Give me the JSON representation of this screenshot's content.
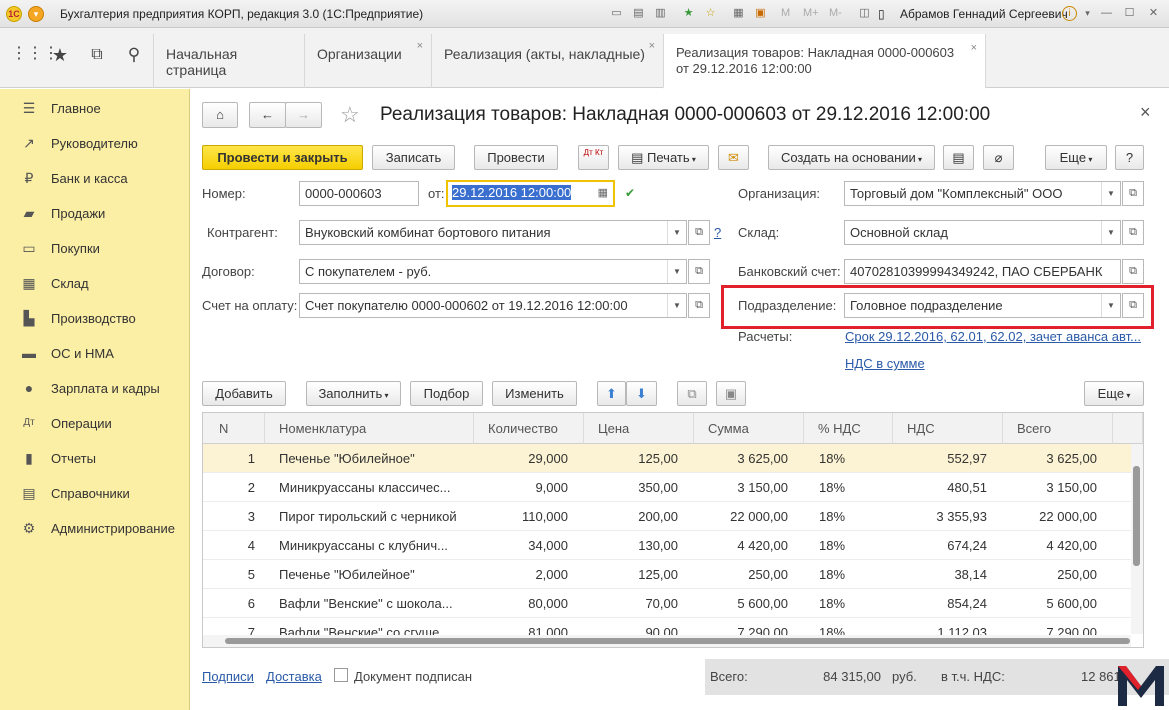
{
  "window": {
    "title": "Бухгалтерия предприятия КОРП, редакция 3.0  (1С:Предприятие)",
    "toolbar_icons": [
      "monitor-icon",
      "printer-icon",
      "printer-2-icon",
      "bookmark-icon",
      "star-icon",
      "calculator-icon",
      "calendar-icon",
      "copy-icon"
    ],
    "memory_labels": [
      "M",
      "M+",
      "M-"
    ],
    "user": "Абрамов Геннадий Сергеевич",
    "info_icon": "info-icon",
    "minimize": "—",
    "maximize": "☐",
    "close": "✕"
  },
  "topnav": {
    "icons": [
      "apps-grid-icon",
      "star-icon",
      "history-icon",
      "search-icon"
    ],
    "tabs": [
      {
        "label": "Начальная страница",
        "closable": false
      },
      {
        "label": "Организации",
        "closable": true
      },
      {
        "label": "Реализация (акты, накладные)",
        "closable": true
      },
      {
        "label": "Реализация товаров: Накладная 0000-000603",
        "label2": "от 29.12.2016 12:00:00",
        "closable": true,
        "active": true
      }
    ],
    "close_glyph": "×"
  },
  "sidebar": {
    "items": [
      {
        "icon": "menu-lines-icon",
        "glyph": "☰",
        "label": "Главное"
      },
      {
        "icon": "trend-icon",
        "glyph": "↗",
        "label": "Руководителю"
      },
      {
        "icon": "ruble-icon",
        "glyph": "₽",
        "label": "Банк и касса"
      },
      {
        "icon": "cart-icon",
        "glyph": "▰",
        "label": "Продажи"
      },
      {
        "icon": "basket-icon",
        "glyph": "▭",
        "label": "Покупки"
      },
      {
        "icon": "warehouse-icon",
        "glyph": "▦",
        "label": "Склад"
      },
      {
        "icon": "factory-icon",
        "glyph": "▙",
        "label": "Производство"
      },
      {
        "icon": "truck-icon",
        "glyph": "▬",
        "label": "ОС и НМА"
      },
      {
        "icon": "people-icon",
        "glyph": "●",
        "label": "Зарплата и кадры"
      },
      {
        "icon": "dt-kt-icon",
        "glyph": "Дт",
        "label": "Операции"
      },
      {
        "icon": "report-icon",
        "glyph": "▮",
        "label": "Отчеты"
      },
      {
        "icon": "book-icon",
        "glyph": "▤",
        "label": "Справочники"
      },
      {
        "icon": "gear-icon",
        "glyph": "⚙",
        "label": "Администрирование"
      }
    ]
  },
  "form": {
    "title": "Реализация товаров: Накладная 0000-000603 от 29.12.2016 12:00:00",
    "close_glyph": "×",
    "toolbar": {
      "post_close": "Провести и закрыть",
      "save": "Записать",
      "post": "Провести",
      "dtkt": "Дт Кт",
      "print": "Печать",
      "create_based": "Создать на основании",
      "more": "Еще",
      "help": "?"
    },
    "fields": {
      "number_label": "Номер:",
      "number_value": "0000-000603",
      "date_label": "от:",
      "date_value": "29.12.2016 12:00:00",
      "org_label": "Организация:",
      "org_value": "Торговый дом \"Комплексный\" ООО",
      "contractor_label": "Контрагент:",
      "contractor_value": "Внуковский комбинат бортового питания",
      "contractor_help": "?",
      "warehouse_label": "Склад:",
      "warehouse_value": "Основной склад",
      "contract_label": "Договор:",
      "contract_value": "С покупателем - руб.",
      "bank_label": "Банковский счет:",
      "bank_value": "40702810399994349242, ПАО СБЕРБАНК",
      "invoice_label": "Счет на оплату:",
      "invoice_value": "Счет покупателю 0000-000602 от 19.12.2016 12:00:00",
      "division_label": "Подразделение:",
      "division_value": "Головное подразделение",
      "settlements_label": "Расчеты:",
      "settlements_link": "Срок 29.12.2016, 62.01, 62.02, зачет аванса авт...",
      "vat_link": "НДС в сумме"
    },
    "grid_toolbar": {
      "add": "Добавить",
      "fill": "Заполнить",
      "select": "Подбор",
      "change": "Изменить",
      "more": "Еще"
    },
    "columns": [
      "N",
      "Номенклатура",
      "Количество",
      "Цена",
      "Сумма",
      "% НДС",
      "НДС",
      "Всего"
    ],
    "rows": [
      {
        "n": "1",
        "name": "Печенье \"Юбилейное\"",
        "qty": "29,000",
        "price": "125,00",
        "sum": "3 625,00",
        "vat_rate": "18%",
        "vat": "552,97",
        "total": "3 625,00"
      },
      {
        "n": "2",
        "name": "Миникруассаны классичес...",
        "qty": "9,000",
        "price": "350,00",
        "sum": "3 150,00",
        "vat_rate": "18%",
        "vat": "480,51",
        "total": "3 150,00"
      },
      {
        "n": "3",
        "name": "Пирог тирольский с черникой",
        "qty": "110,000",
        "price": "200,00",
        "sum": "22 000,00",
        "vat_rate": "18%",
        "vat": "3 355,93",
        "total": "22 000,00"
      },
      {
        "n": "4",
        "name": "Миникруассаны с клубнич...",
        "qty": "34,000",
        "price": "130,00",
        "sum": "4 420,00",
        "vat_rate": "18%",
        "vat": "674,24",
        "total": "4 420,00"
      },
      {
        "n": "5",
        "name": "Печенье \"Юбилейное\"",
        "qty": "2,000",
        "price": "125,00",
        "sum": "250,00",
        "vat_rate": "18%",
        "vat": "38,14",
        "total": "250,00"
      },
      {
        "n": "6",
        "name": "Вафли \"Венские\" с шокола...",
        "qty": "80,000",
        "price": "70,00",
        "sum": "5 600,00",
        "vat_rate": "18%",
        "vat": "854,24",
        "total": "5 600,00"
      },
      {
        "n": "7",
        "name": "Вафли \"Венские\" со сгуще...",
        "qty": "81,000",
        "price": "90,00",
        "sum": "7 290,00",
        "vat_rate": "18%",
        "vat": "1 112,03",
        "total": "7 290,00"
      }
    ],
    "footer": {
      "signatures_link": "Подписи",
      "delivery_link": "Доставка",
      "signed_label": "Документ подписан",
      "total_label": "Всего:",
      "total_value": "84 315,00",
      "currency": "руб.",
      "vat_label": "в т.ч. НДС:",
      "vat_value": "12 861,"
    },
    "highlight_color": "#e0202a",
    "accent_yellow": "#f5cf00",
    "sidebar_color": "#fbeea5"
  }
}
